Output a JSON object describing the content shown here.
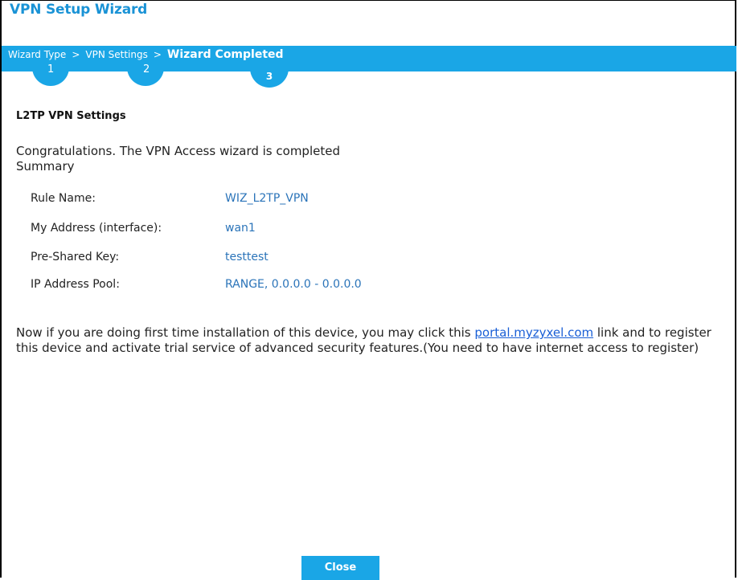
{
  "window": {
    "title": "VPN Setup Wizard"
  },
  "steps": {
    "crumbs": [
      {
        "label": "Wizard Type",
        "number": "1"
      },
      {
        "label": "VPN Settings",
        "number": "2"
      },
      {
        "label": "Wizard Completed",
        "number": "3"
      }
    ],
    "separator": ">"
  },
  "section": {
    "title": "L2TP VPN Settings"
  },
  "messages": {
    "congrats": "Congratulations. The VPN Access wizard is completed",
    "summary": "Summary"
  },
  "summary": {
    "rule_name_label": "Rule Name:",
    "rule_name_value": "WIZ_L2TP_VPN",
    "my_address_label": "My Address (interface):",
    "my_address_value": "wan1",
    "psk_label": "Pre-Shared Key:",
    "psk_value": "testtest",
    "pool_label": "IP Address Pool:",
    "pool_value": "RANGE, 0.0.0.0 - 0.0.0.0"
  },
  "note": {
    "before_link": "Now if you are doing first time installation of this device, you may click this ",
    "link_text": "portal.myzyxel.com",
    "after_link": " link and to register this device and activate trial service of advanced security features.(You need to have internet access to register)"
  },
  "footer": {
    "close_label": "Close"
  },
  "colors": {
    "accent": "#1aa6e6",
    "title": "#1a93d6",
    "value": "#2b74b9",
    "link": "#1a5fd6"
  }
}
